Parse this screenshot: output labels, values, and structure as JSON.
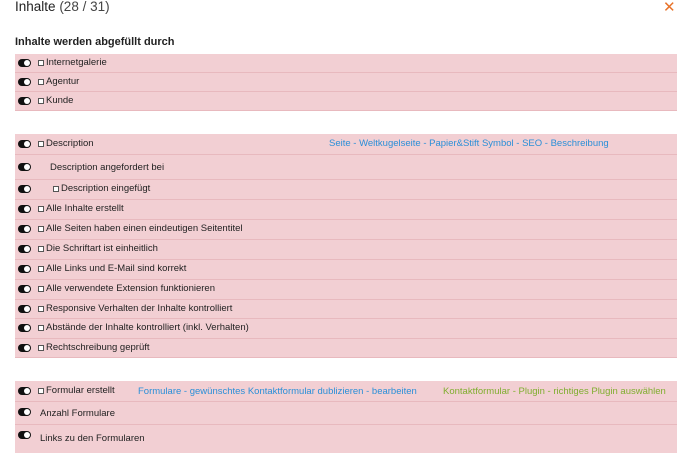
{
  "dialog": {
    "title": "Inhalte",
    "count": "(28 / 31)",
    "close_glyph": "✕",
    "subtitle": "Inhalte werden abgefüllt durch"
  },
  "rows": [
    {
      "label": "Internetgalerie"
    },
    {
      "label": "Agentur"
    },
    {
      "label": "Kunde"
    },
    {
      "label": "Description",
      "links": [
        "Seite - Weltkugelseite - Papier&Stift Symbol - SEO - Beschreibung"
      ]
    },
    {
      "label": "Description angefordert bei"
    },
    {
      "label": "Description eingefügt"
    },
    {
      "label": "Alle Inhalte erstellt"
    },
    {
      "label": "Alle Seiten haben einen eindeutigen Seitentitel"
    },
    {
      "label": "Die Schriftart ist einheitlich"
    },
    {
      "label": "Alle Links und E-Mail sind korrekt"
    },
    {
      "label": "Alle verwendete Extension funktionieren"
    },
    {
      "label": "Responsive Verhalten der Inhalte kontrolliert"
    },
    {
      "label": "Abstände der Inhalte kontrolliert (inkl. Verhalten)"
    },
    {
      "label": "Rechtschreibung geprüft"
    },
    {
      "label": "Formular erstellt",
      "links": [
        "Formulare - gewünschtes Kontaktformular dublizieren - bearbeiten",
        "Kontaktformular - Plugin - richtiges Plugin auswählen"
      ]
    },
    {
      "label": "Anzahl Formulare"
    },
    {
      "label": "Links zu den Formularen"
    }
  ],
  "colors": {
    "row_background": "#f2cfd3",
    "link_blue": "#2a8fd8",
    "link_green": "#7fae2f",
    "close_orange": "#e8732a"
  }
}
